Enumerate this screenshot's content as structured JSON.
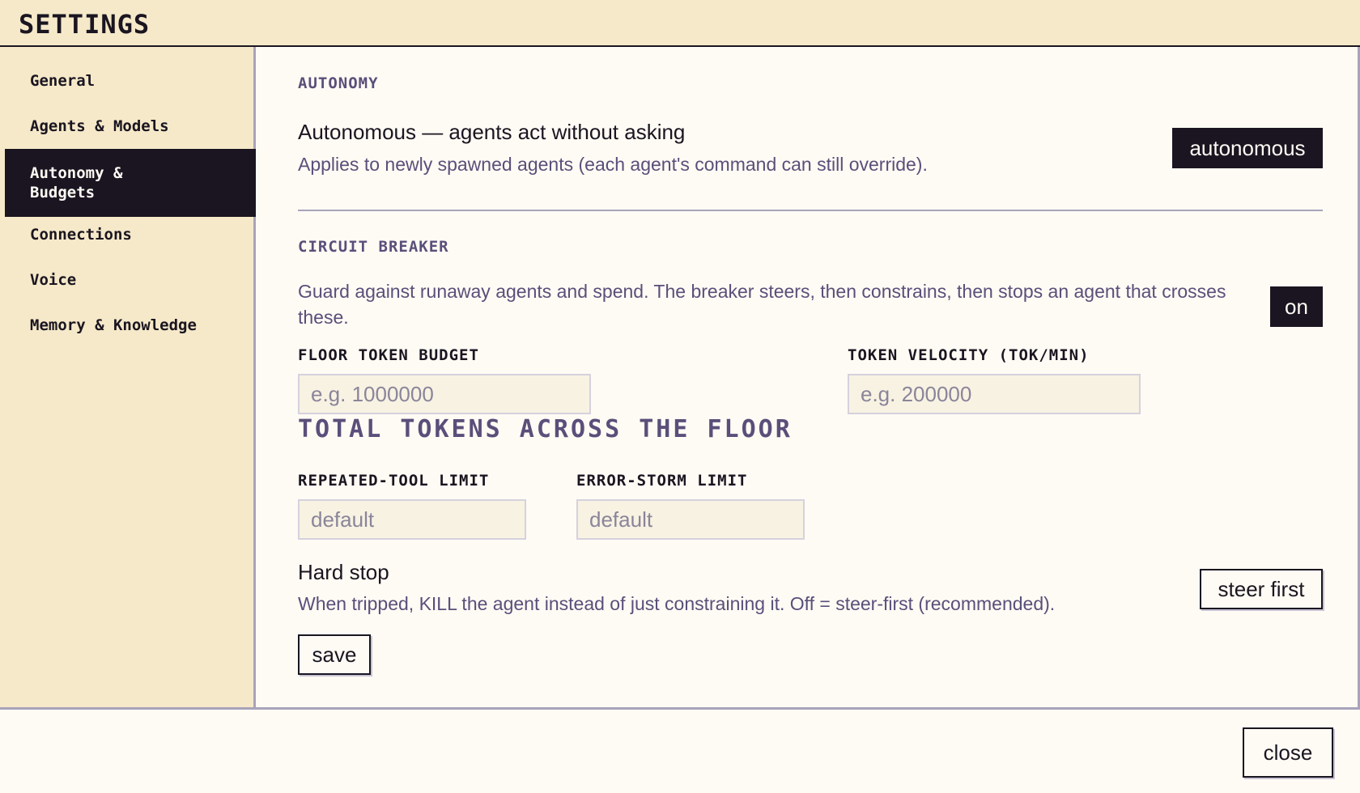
{
  "window": {
    "title": "SETTINGS"
  },
  "sidebar": {
    "items": [
      {
        "label": "General",
        "active": false
      },
      {
        "label": "Agents & Models",
        "active": false
      },
      {
        "label": "Autonomy & Budgets",
        "active": true
      },
      {
        "label": "Connections",
        "active": false
      },
      {
        "label": "Voice",
        "active": false
      },
      {
        "label": "Memory & Knowledge",
        "active": false
      }
    ]
  },
  "autonomy": {
    "section_title": "AUTONOMY",
    "mode_label": "Autonomous — agents act without asking",
    "mode_description": "Applies to newly spawned agents (each agent's command can still override).",
    "mode_button": "autonomous"
  },
  "circuit_breaker": {
    "section_title": "CIRCUIT BREAKER",
    "description": "Guard against runaway agents and spend. The breaker steers, then constrains, then stops an agent that crosses these.",
    "toggle_label": "on",
    "floor_token_budget": {
      "label": "FLOOR TOKEN BUDGET",
      "value": "",
      "placeholder": "e.g. 1000000",
      "hint": "TOTAL TOKENS ACROSS THE FLOOR"
    },
    "token_velocity": {
      "label": "TOKEN VELOCITY (TOK/MIN)",
      "value": "",
      "placeholder": "e.g. 200000"
    },
    "repeated_tool_limit": {
      "label": "REPEATED-TOOL LIMIT",
      "value": "",
      "placeholder": "default"
    },
    "error_storm_limit": {
      "label": "ERROR-STORM LIMIT",
      "value": "",
      "placeholder": "default"
    },
    "hard_stop": {
      "label": "Hard stop",
      "description": "When tripped, KILL the agent instead of just constraining it. Off = steer-first (recommended).",
      "button": "steer first"
    },
    "save_label": "save"
  },
  "footer": {
    "close_label": "close"
  },
  "colors": {
    "accent_dark": "#1a1520",
    "muted_purple": "#5a4f7a",
    "sidebar_bg": "#f5e9c9",
    "panel_bg": "#fdfbf4"
  }
}
